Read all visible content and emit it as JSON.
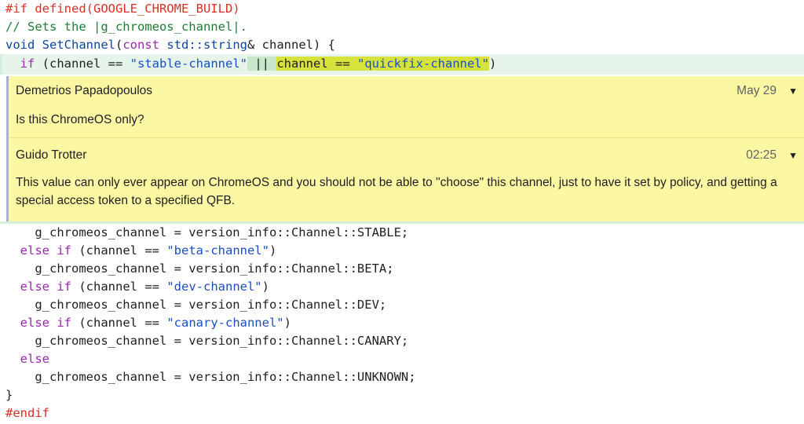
{
  "code_before": {
    "line1": {
      "directive": "#if defined(GOOGLE_CHROME_BUILD)"
    },
    "line2": {
      "comment": "// Sets the |g_chromeos_channel|."
    },
    "line3": {
      "type": "void",
      "func": "SetChannel",
      "open": "(",
      "kw_const": "const",
      "std_type": "std::string",
      "rest": "& channel) {"
    },
    "line4": {
      "kw_if": "if",
      "part_a": " (channel == ",
      "str_stable": "\"stable-channel\"",
      "sp": " ",
      "op_or": "||",
      "sp2": " ",
      "part_b": "channel == ",
      "str_quickfix": "\"quickfix-channel\"",
      "close": ")"
    }
  },
  "comment_thread": {
    "comments": [
      {
        "author": "Demetrios Papadopoulos",
        "date": "May 29",
        "toggle": "▼",
        "body": "Is this ChromeOS only?"
      },
      {
        "author": "Guido Trotter",
        "date": "02:25",
        "toggle": "▼",
        "body": "This value can only ever appear on ChromeOS and you should not be able to \"choose\" this channel, just to have it set by policy, and getting a special access token to a specified QFB."
      }
    ]
  },
  "code_after": {
    "l5": "    g_chromeos_channel = version_info::Channel::STABLE;",
    "l6": {
      "kw": "else if",
      "a": " (channel == ",
      "s": "\"beta-channel\"",
      "b": ")"
    },
    "l7": "    g_chromeos_channel = version_info::Channel::BETA;",
    "l8": {
      "kw": "else if",
      "a": " (channel == ",
      "s": "\"dev-channel\"",
      "b": ")"
    },
    "l9": "    g_chromeos_channel = version_info::Channel::DEV;",
    "l10": {
      "kw": "else if",
      "a": " (channel == ",
      "s": "\"canary-channel\"",
      "b": ")"
    },
    "l11": "    g_chromeos_channel = version_info::Channel::CANARY;",
    "l12": {
      "kw": "else"
    },
    "l13": "    g_chromeos_channel = version_info::Channel::UNKNOWN;",
    "l14": "}",
    "l15": {
      "directive": "#endif"
    }
  },
  "colors": {
    "preprocessor": "#d93025",
    "comment": "#1e7e34",
    "keyword": "#9c27b0",
    "type": "#0d47a1",
    "string": "#1a4fc4",
    "thread_bg": "#fbf7a2",
    "changed_line_bg": "#e6f4ea",
    "selection": "#d8e23c"
  }
}
